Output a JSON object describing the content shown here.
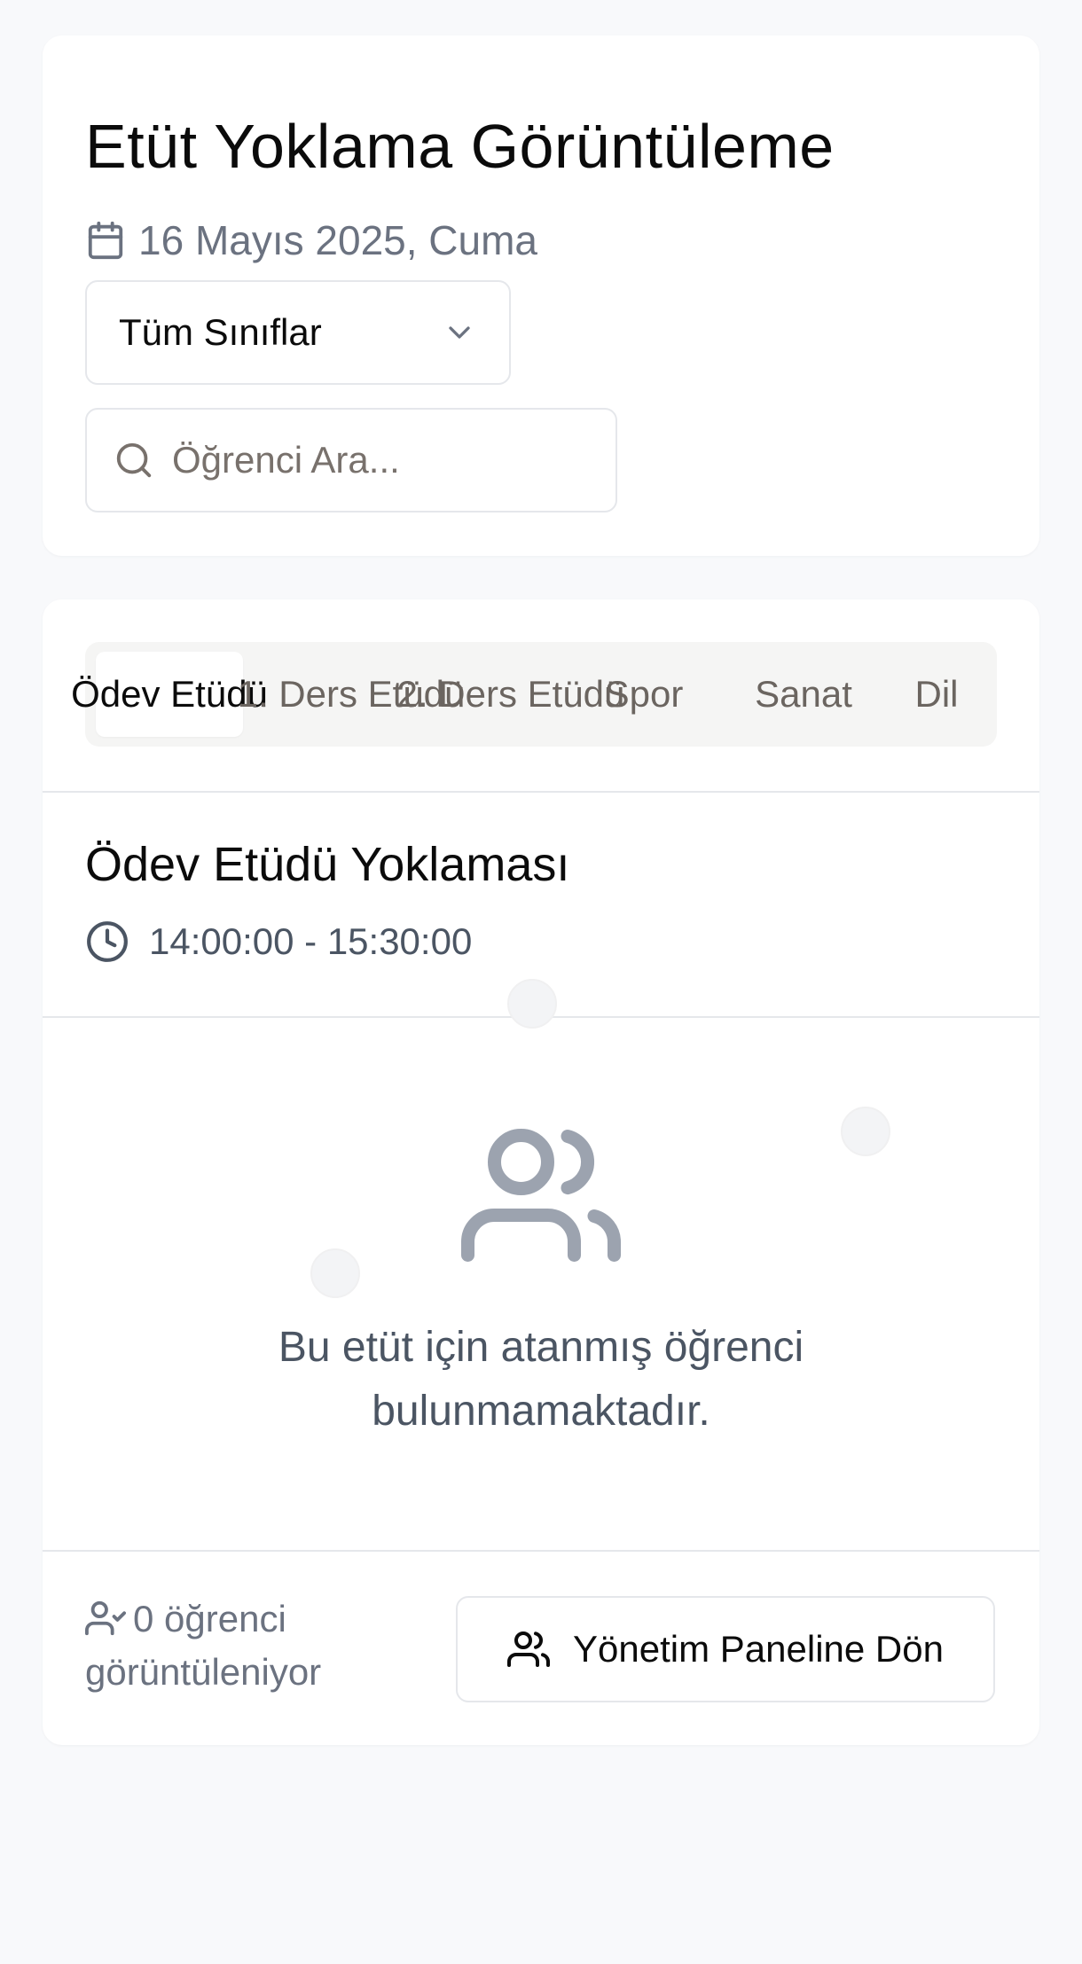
{
  "header": {
    "title": "Etüt Yoklama Görüntüleme",
    "date": "16 Mayıs 2025, Cuma",
    "class_filter": {
      "selected": "Tüm Sınıflar"
    },
    "search": {
      "placeholder": "Öğrenci Ara..."
    }
  },
  "tabs": [
    {
      "label": "Ödev Etüdü",
      "active": true
    },
    {
      "label": "1. Ders Etüdü",
      "active": false
    },
    {
      "label": "2. Ders Etüdü",
      "active": false
    },
    {
      "label": "Spor",
      "active": false
    },
    {
      "label": "Sanat",
      "active": false
    },
    {
      "label": "Dil",
      "active": false
    }
  ],
  "session": {
    "title": "Ödev Etüdü Yoklaması",
    "time": "14:00:00 - 15:30:00"
  },
  "empty_state": {
    "message": "Bu etüt için atanmış öğrenci bulunmamaktadır."
  },
  "footer": {
    "count_text": "0 öğrenci görüntüleniyor",
    "back_button": "Yönetim Paneline Dön"
  },
  "colors": {
    "background": "#f8f9fb",
    "card": "#ffffff",
    "muted_text": "#6b7280",
    "icon_gray": "#9ca3af",
    "border": "#e5e7eb",
    "tab_bg": "#f5f5f4"
  }
}
